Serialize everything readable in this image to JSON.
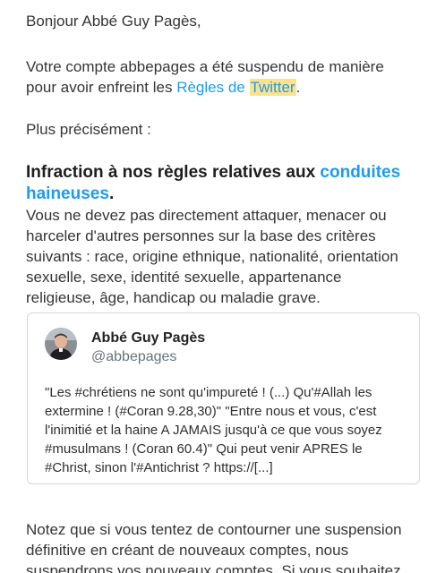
{
  "greeting": "Bonjour Abbé Guy Pagès,",
  "suspension": {
    "line1": "Votre compte abbepages a été suspendu de manière",
    "line2_prefix": "pour avoir enfreint les ",
    "rules_link": "Règles de",
    "space": " ",
    "twitter_highlight": "Twitter",
    "line2_suffix": "."
  },
  "precisely": "Plus précisément :",
  "infraction": {
    "heading_prefix": "Infraction à nos règles relatives aux ",
    "heading_link_1": "conduites",
    "heading_link_2": "haineuses",
    "heading_suffix": ".",
    "body_lines": [
      "Vous ne devez pas directement attaquer, menacer ou",
      "harceler d'autres personnes sur la base des critères",
      "suivants : race, origine ethnique, nationalité, orientation",
      "sexuelle, sexe, identité sexuelle, appartenance",
      "religieuse, âge, handicap ou maladie grave."
    ]
  },
  "tweet": {
    "author_name": "Abbé Guy Pagès",
    "author_handle": "@abbepages",
    "text_lines": [
      "\"Les #chrétiens ne sont qu'impureté ! (...) Qu'#Allah les",
      "extermine ! (#Coran 9.28,30)\" \"Entre nous et vous, c'est",
      "l'inimitié et la haine A JAMAIS jusqu'à ce que vous soyez",
      "#musulmans ! (Coran 60.4)\" Qui peut venir APRES le",
      "#Christ, sinon l'#Antichrist ? https://[...]"
    ]
  },
  "footer": {
    "lines": [
      "Notez que si vous tentez de contourner une suspension",
      "définitive en créant de nouveaux comptes, nous",
      "suspendrons vos nouveaux comptes. Si vous souhaitez"
    ]
  },
  "colors": {
    "link": "#1d9bf0",
    "highlight": "#fbe38e",
    "text": "#353535",
    "handle": "#667380",
    "card_border": "#cfd9de"
  },
  "icons": {
    "avatar": "profile-photo"
  }
}
